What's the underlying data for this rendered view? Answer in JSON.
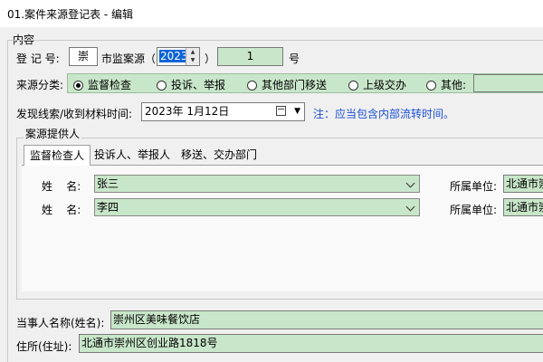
{
  "window": {
    "title": "01.案件来源登记表 - 编辑"
  },
  "content_group": {
    "label": "内容"
  },
  "registration": {
    "label": "登 记 号:",
    "prefix": "崇",
    "unit_label": "市监案源（",
    "year": "2023",
    "close_paren": "）",
    "number": "1",
    "suffix": "号"
  },
  "source_type": {
    "label": "来源分类:",
    "options": [
      "监督检查",
      "投诉、举报",
      "其他部门移送",
      "上级交办",
      "其他:"
    ],
    "selected": "监督检查",
    "other_value": ""
  },
  "discovery": {
    "label": "发现线索/收到材料时间:",
    "date": "2023年  1月12日",
    "note": "注：应当包含内部流转时间。"
  },
  "provider_group": {
    "label": "案源提供人"
  },
  "tabs": [
    "监督检查人",
    "投诉人、举报人",
    "移送、交办部门"
  ],
  "inspectors": [
    {
      "name_label": "姓    名:",
      "name": "张三",
      "unit_label": "所属单位:",
      "unit": "北通市崇"
    },
    {
      "name_label": "姓    名:",
      "name": "李四",
      "unit_label": "所属单位:",
      "unit": "北通市崇"
    }
  ],
  "party": {
    "label": "当事人名称(姓名):",
    "value": "崇州区美味餐饮店"
  },
  "address": {
    "label": "住所(住址):",
    "value": "北通市崇州区创业路1818号"
  },
  "colors": {
    "field_green": "#c8e6c9",
    "note_blue": "#1a4fd6",
    "selection_blue": "#0a64d6"
  },
  "icons": [
    "spin-up-icon",
    "spin-down-icon",
    "calendar-icon",
    "chevron-down-icon",
    "radio-icon"
  ]
}
